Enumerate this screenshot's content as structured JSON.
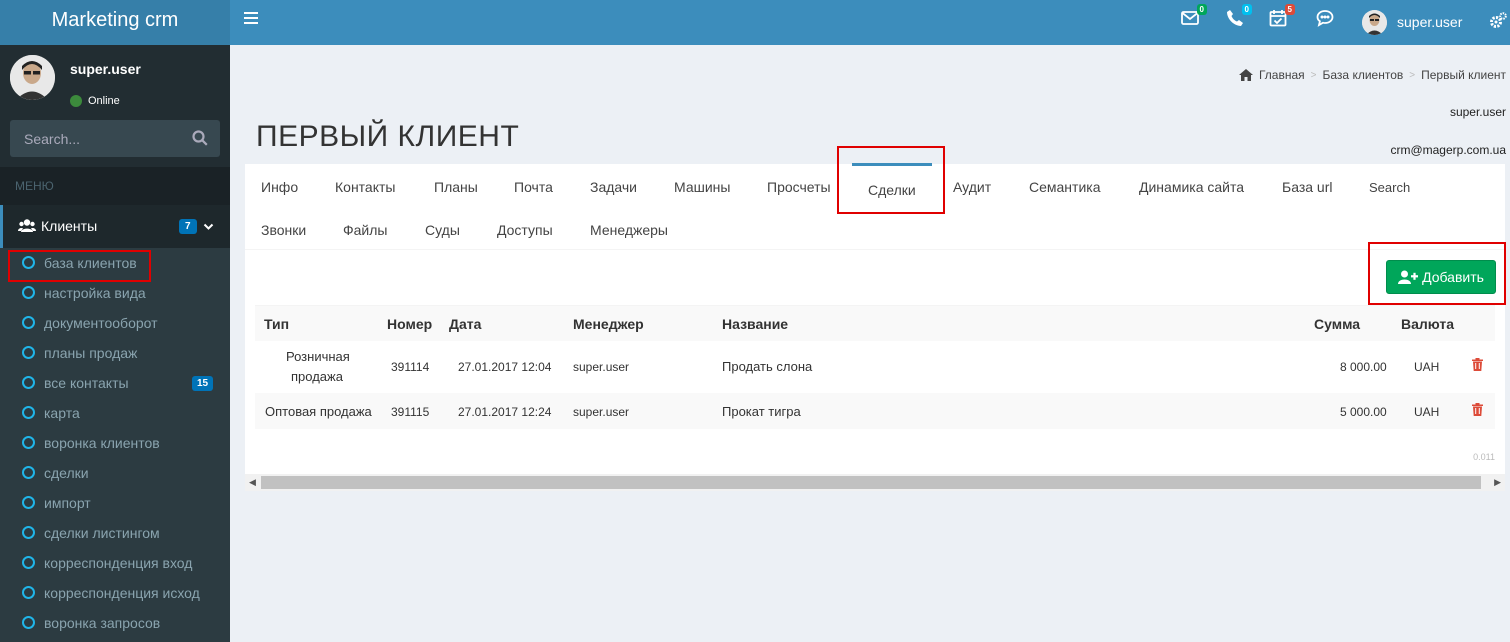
{
  "header": {
    "logo": "Marketing crm",
    "mail_count": "0",
    "phone_count": "0",
    "tasks_count": "5",
    "user_name": "super.user",
    "colors": {
      "header": "#3c8dbc",
      "logo_bg": "#367fa9",
      "badge_green": "#00a65a",
      "badge_aqua": "#00c0ef",
      "badge_red": "#dd4b39"
    }
  },
  "sidebar": {
    "user_name": "super.user",
    "status": "Online",
    "search_placeholder": "Search...",
    "menu_header": "МЕНЮ",
    "clients": {
      "label": "Клиенты",
      "count": "7"
    },
    "items": [
      {
        "label": "база клиентов"
      },
      {
        "label": "настройка вида"
      },
      {
        "label": "документооборот"
      },
      {
        "label": "планы продаж"
      },
      {
        "label": "все контакты",
        "count": "15"
      },
      {
        "label": "карта"
      },
      {
        "label": "воронка клиентов"
      },
      {
        "label": "сделки"
      },
      {
        "label": "импорт"
      },
      {
        "label": "сделки листингом"
      },
      {
        "label": "корреспонденция вход"
      },
      {
        "label": "корреспонденция исход"
      },
      {
        "label": "воронка запросов"
      }
    ]
  },
  "breadcrumb": {
    "home": "Главная",
    "level2": "База клиентов",
    "current": "Первый клиент"
  },
  "page": {
    "title": "ПЕРВЫЙ КЛИЕНТ",
    "user": "super.user",
    "email": "crm@magerp.com.ua"
  },
  "tabs": {
    "row1": [
      "Инфо",
      "Контакты",
      "Планы",
      "Почта",
      "Задачи",
      "Машины",
      "Просчеты",
      "Сделки",
      "Аудит",
      "Семантика",
      "Динамика сайта",
      "База url",
      "Search"
    ],
    "row2": [
      "Звонки",
      "Файлы",
      "Суды",
      "Доступы",
      "Менеджеры"
    ],
    "active": "Сделки"
  },
  "add_button": "Добавить",
  "table": {
    "headers": [
      "Тип",
      "Номер",
      "Дата",
      "Менеджер",
      "Название",
      "Сумма",
      "Валюта"
    ],
    "rows": [
      {
        "type_line1": "Розничная",
        "type_line2": "продажа",
        "number": "391114",
        "date": "27.01.2017 12:04",
        "manager": "super.user",
        "name": "Продать слона",
        "sum": "8 000.00",
        "currency": "UAH"
      },
      {
        "type": "Оптовая продажа",
        "number": "391115",
        "date": "27.01.2017 12:24",
        "manager": "super.user",
        "name": "Прокат тигра",
        "sum": "5 000.00",
        "currency": "UAH"
      }
    ]
  },
  "timer": "0.011"
}
